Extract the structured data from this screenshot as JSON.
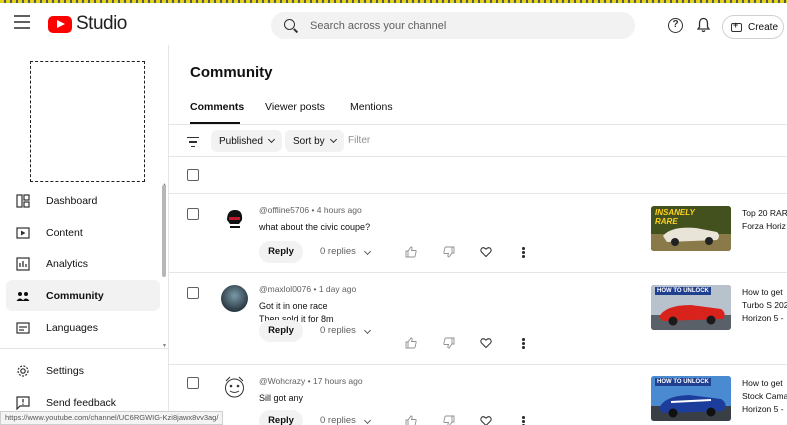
{
  "header": {
    "logo_text": "Studio",
    "search_placeholder": "Search across your channel",
    "help_glyph": "?",
    "create_label": "Create"
  },
  "sidebar": {
    "items": [
      {
        "label": "Dashboard",
        "icon": "dashboard-icon"
      },
      {
        "label": "Content",
        "icon": "content-icon"
      },
      {
        "label": "Analytics",
        "icon": "analytics-icon"
      },
      {
        "label": "Community",
        "icon": "community-icon",
        "active": true
      },
      {
        "label": "Languages",
        "icon": "languages-icon"
      }
    ],
    "bottom_items": [
      {
        "label": "Settings",
        "icon": "gear-icon"
      },
      {
        "label": "Send feedback",
        "icon": "feedback-icon"
      }
    ]
  },
  "status_url": "https://www.youtube.com/channel/UC6RGWIG-Kzi8jawx8vv3ag/",
  "main": {
    "title": "Community",
    "tabs": [
      {
        "label": "Comments",
        "active": true
      },
      {
        "label": "Viewer posts"
      },
      {
        "label": "Mentions"
      }
    ],
    "filters": {
      "published_label": "Published",
      "sort_label": "Sort by",
      "filter_placeholder": "Filter"
    },
    "reply_label": "Reply",
    "comments": [
      {
        "author": "@offline5706",
        "time": "4 hours ago",
        "lines": [
          "what about the civic coupe?"
        ],
        "replies": "0 replies",
        "video_title_1": "Top 20 RAR",
        "video_title_2": "Forza Horiz",
        "thumb_text": "INSANELY RARE"
      },
      {
        "author": "@maxlol0076",
        "time": "1 day ago",
        "lines": [
          "Got it in one race",
          "Then sold it for 8m"
        ],
        "replies": "0 replies",
        "video_title_1": "How to get",
        "video_title_2": "Turbo S 202",
        "video_title_3": "Horizon 5 -",
        "thumb_text": "HOW TO UNLOCK"
      },
      {
        "author": "@Wohcrazy",
        "time": "17 hours ago",
        "lines": [
          "Sill got any"
        ],
        "replies": "0 replies",
        "video_title_1": "How to get",
        "video_title_2": "Stock Cama",
        "video_title_3": "Horizon 5 -",
        "thumb_text": "HOW TO UNLOCK"
      }
    ]
  }
}
